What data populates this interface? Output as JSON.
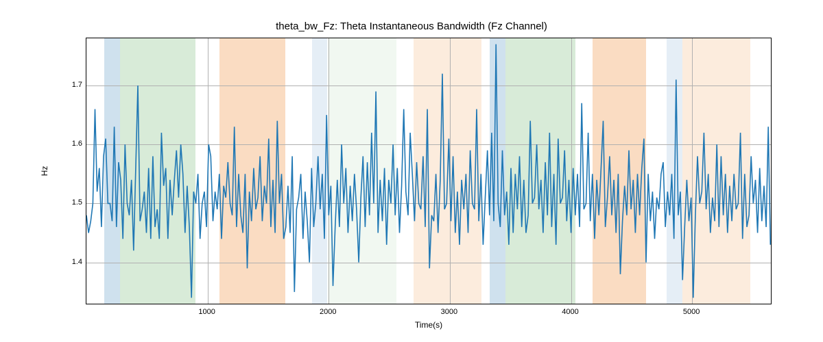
{
  "chart_data": {
    "type": "line",
    "title": "theta_bw_Fz: Theta Instantaneous Bandwidth (Fz Channel)",
    "xlabel": "Time(s)",
    "ylabel": "Hz",
    "xlim": [
      0,
      5650
    ],
    "ylim": [
      1.33,
      1.78
    ],
    "x_ticks": [
      1000,
      2000,
      3000,
      4000,
      5000
    ],
    "y_ticks": [
      1.4,
      1.5,
      1.6,
      1.7
    ],
    "bands": [
      {
        "x0": 150,
        "x1": 275,
        "color": "#a8c8e0",
        "opacity": 0.55
      },
      {
        "x0": 275,
        "x1": 900,
        "color": "#b8dab8",
        "opacity": 0.55
      },
      {
        "x0": 1100,
        "x1": 1640,
        "color": "#f5c090",
        "opacity": 0.55
      },
      {
        "x0": 1860,
        "x1": 1990,
        "color": "#a8c8e0",
        "opacity": 0.3
      },
      {
        "x0": 1990,
        "x1": 2560,
        "color": "#b8dab8",
        "opacity": 0.2
      },
      {
        "x0": 2700,
        "x1": 3260,
        "color": "#f5c090",
        "opacity": 0.3
      },
      {
        "x0": 3330,
        "x1": 3460,
        "color": "#a8c8e0",
        "opacity": 0.55
      },
      {
        "x0": 3460,
        "x1": 4035,
        "color": "#b8dab8",
        "opacity": 0.55
      },
      {
        "x0": 4180,
        "x1": 4620,
        "color": "#f5c090",
        "opacity": 0.55
      },
      {
        "x0": 4790,
        "x1": 4920,
        "color": "#a8c8e0",
        "opacity": 0.3
      },
      {
        "x0": 4920,
        "x1": 5480,
        "color": "#f5c090",
        "opacity": 0.3
      }
    ],
    "series": [
      {
        "name": "theta_bw_Fz",
        "color": "#1f77b4",
        "x_start": 0,
        "x_step": 17.7,
        "values": [
          1.48,
          1.45,
          1.47,
          1.5,
          1.66,
          1.52,
          1.56,
          1.46,
          1.58,
          1.61,
          1.5,
          1.5,
          1.47,
          1.63,
          1.46,
          1.57,
          1.54,
          1.44,
          1.6,
          1.5,
          1.48,
          1.54,
          1.42,
          1.56,
          1.7,
          1.47,
          1.49,
          1.52,
          1.45,
          1.56,
          1.44,
          1.58,
          1.46,
          1.49,
          1.44,
          1.62,
          1.53,
          1.56,
          1.44,
          1.54,
          1.48,
          1.54,
          1.59,
          1.51,
          1.6,
          1.55,
          1.45,
          1.53,
          1.46,
          1.34,
          1.52,
          1.5,
          1.55,
          1.44,
          1.5,
          1.52,
          1.46,
          1.6,
          1.58,
          1.47,
          1.52,
          1.49,
          1.55,
          1.44,
          1.53,
          1.51,
          1.57,
          1.5,
          1.48,
          1.63,
          1.46,
          1.55,
          1.48,
          1.45,
          1.55,
          1.39,
          1.52,
          1.47,
          1.56,
          1.49,
          1.51,
          1.58,
          1.47,
          1.53,
          1.5,
          1.61,
          1.46,
          1.54,
          1.45,
          1.64,
          1.5,
          1.55,
          1.44,
          1.46,
          1.53,
          1.45,
          1.58,
          1.35,
          1.49,
          1.51,
          1.55,
          1.44,
          1.52,
          1.47,
          1.4,
          1.56,
          1.46,
          1.5,
          1.58,
          1.49,
          1.55,
          1.44,
          1.65,
          1.48,
          1.53,
          1.36,
          1.46,
          1.54,
          1.46,
          1.6,
          1.5,
          1.56,
          1.45,
          1.53,
          1.47,
          1.55,
          1.49,
          1.4,
          1.51,
          1.58,
          1.46,
          1.57,
          1.48,
          1.62,
          1.5,
          1.69,
          1.45,
          1.54,
          1.47,
          1.56,
          1.43,
          1.54,
          1.5,
          1.6,
          1.48,
          1.56,
          1.45,
          1.53,
          1.66,
          1.52,
          1.48,
          1.62,
          1.55,
          1.47,
          1.57,
          1.5,
          1.49,
          1.58,
          1.46,
          1.66,
          1.39,
          1.48,
          1.47,
          1.55,
          1.45,
          1.54,
          1.72,
          1.49,
          1.5,
          1.61,
          1.47,
          1.58,
          1.45,
          1.52,
          1.43,
          1.54,
          1.49,
          1.55,
          1.45,
          1.59,
          1.5,
          1.49,
          1.66,
          1.47,
          1.55,
          1.43,
          1.51,
          1.59,
          1.48,
          1.62,
          1.47,
          1.77,
          1.5,
          1.46,
          1.59,
          1.48,
          1.52,
          1.43,
          1.56,
          1.45,
          1.55,
          1.49,
          1.58,
          1.46,
          1.54,
          1.45,
          1.48,
          1.64,
          1.5,
          1.51,
          1.6,
          1.49,
          1.54,
          1.45,
          1.57,
          1.48,
          1.62,
          1.46,
          1.55,
          1.43,
          1.61,
          1.5,
          1.51,
          1.59,
          1.47,
          1.54,
          1.45,
          1.56,
          1.48,
          1.55,
          1.46,
          1.67,
          1.49,
          1.5,
          1.62,
          1.47,
          1.55,
          1.44,
          1.54,
          1.48,
          1.56,
          1.64,
          1.46,
          1.51,
          1.58,
          1.48,
          1.54,
          1.45,
          1.55,
          1.38,
          1.47,
          1.53,
          1.48,
          1.59,
          1.49,
          1.54,
          1.45,
          1.55,
          1.48,
          1.56,
          1.61,
          1.4,
          1.55,
          1.47,
          1.52,
          1.44,
          1.51,
          1.49,
          1.55,
          1.57,
          1.46,
          1.52,
          1.48,
          1.55,
          1.44,
          1.71,
          1.48,
          1.52,
          1.37,
          1.46,
          1.54,
          1.47,
          1.51,
          1.34,
          1.48,
          1.58,
          1.5,
          1.52,
          1.62,
          1.49,
          1.55,
          1.45,
          1.51,
          1.47,
          1.6,
          1.46,
          1.58,
          1.48,
          1.55,
          1.45,
          1.53,
          1.47,
          1.55,
          1.49,
          1.5,
          1.62,
          1.44,
          1.55,
          1.46,
          1.48,
          1.58,
          1.5,
          1.54,
          1.45,
          1.56,
          1.47,
          1.53,
          1.46,
          1.63,
          1.43
        ]
      }
    ]
  }
}
